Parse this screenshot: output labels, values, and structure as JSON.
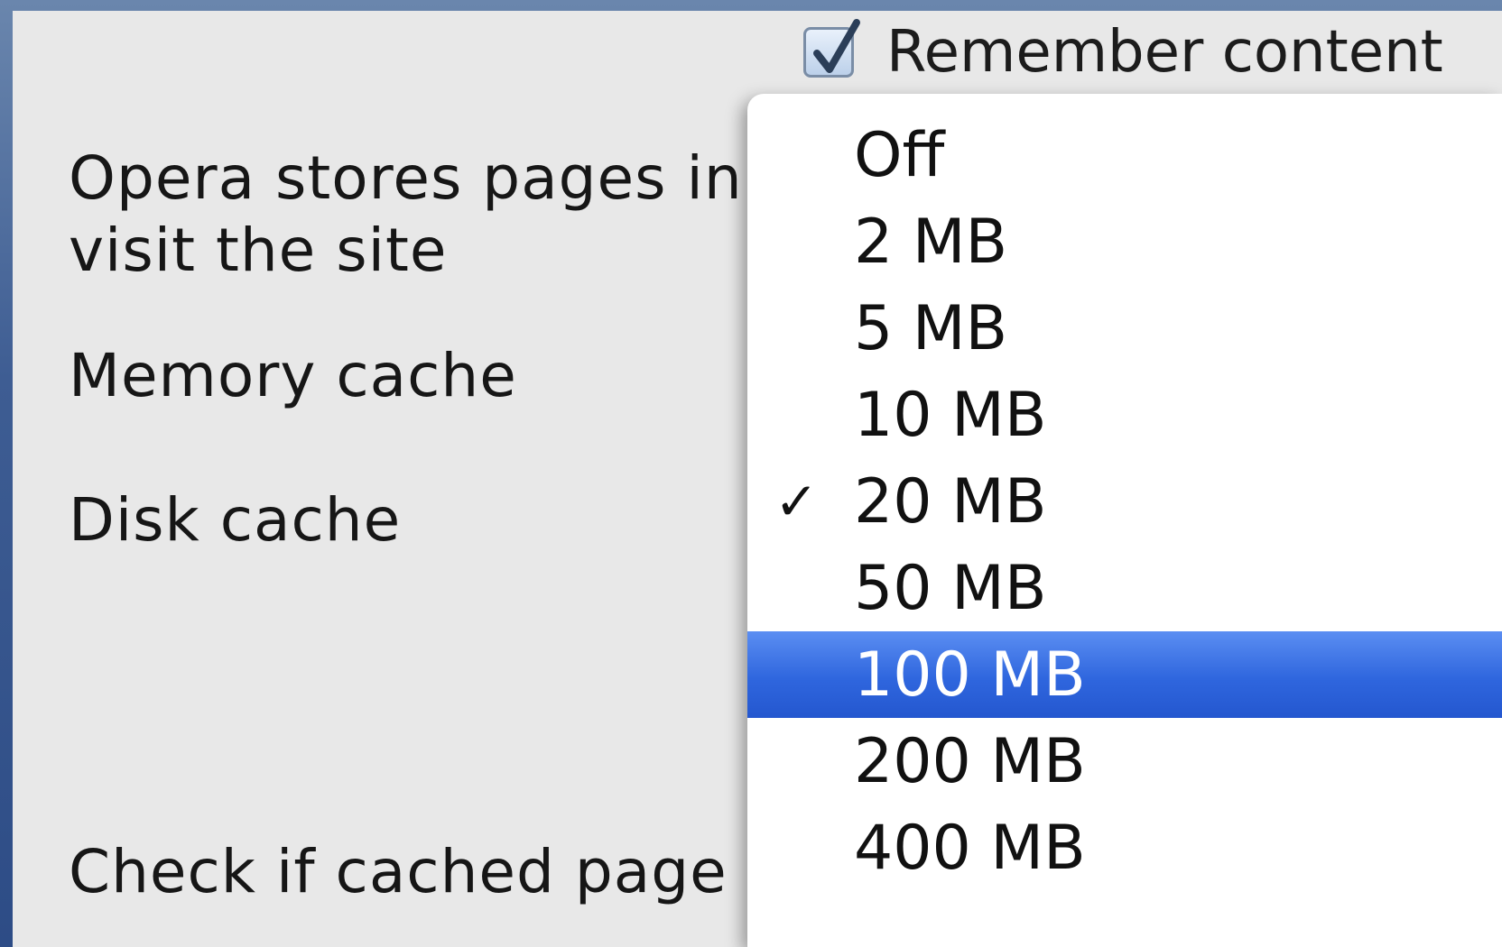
{
  "panel": {
    "remember_checkbox": {
      "label": "Remember content",
      "checked": true
    },
    "description_line1": "Opera stores pages in",
    "description_line2": "visit the site",
    "memory_cache_label": "Memory cache",
    "disk_cache_label": "Disk cache",
    "check_cached_label": "Check if cached page"
  },
  "menu": {
    "items": [
      {
        "label": "Off"
      },
      {
        "label": "2 MB"
      },
      {
        "label": "5 MB"
      },
      {
        "label": "10 MB"
      },
      {
        "label": "20 MB",
        "checkmark": "✓",
        "checked": true
      },
      {
        "label": "50 MB"
      },
      {
        "label": "100 MB",
        "highlighted": true
      },
      {
        "label": "200 MB"
      },
      {
        "label": "400 MB"
      }
    ],
    "highlight_color": "#2f66de"
  }
}
